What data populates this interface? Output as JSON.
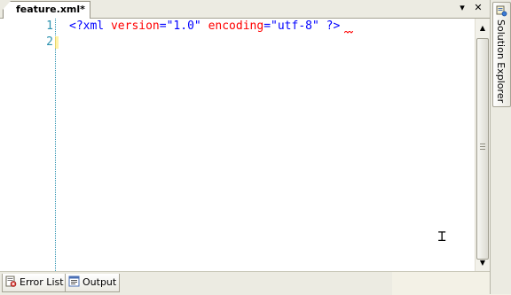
{
  "tabs": {
    "active_document": "feature.xml*",
    "dropdown_glyph": "▾",
    "close_glyph": "✕"
  },
  "editor": {
    "line_numbers": [
      "1",
      "2"
    ],
    "line1": {
      "open": "<?xml",
      "attr1": "version",
      "eq1": "=",
      "val1": "\"1.0\"",
      "attr2": "encoding",
      "eq2": "=",
      "val2": "\"utf-8\"",
      "close": "?>"
    },
    "cursor_icon": "text-cursor-icon"
  },
  "scrollbar": {
    "up_glyph": "▲",
    "down_glyph": "▼"
  },
  "side_panel": {
    "tab_label": "Solution Explorer",
    "icon": "solution-explorer-icon"
  },
  "bottom_tabs": [
    {
      "label": "Error List",
      "icon": "error-list-icon"
    },
    {
      "label": "Output",
      "icon": "output-icon"
    }
  ],
  "colors": {
    "xml_delimiter": "#0000ff",
    "xml_name": "#a31515",
    "xml_attribute": "#ff0000",
    "line_number": "#2b91af"
  }
}
